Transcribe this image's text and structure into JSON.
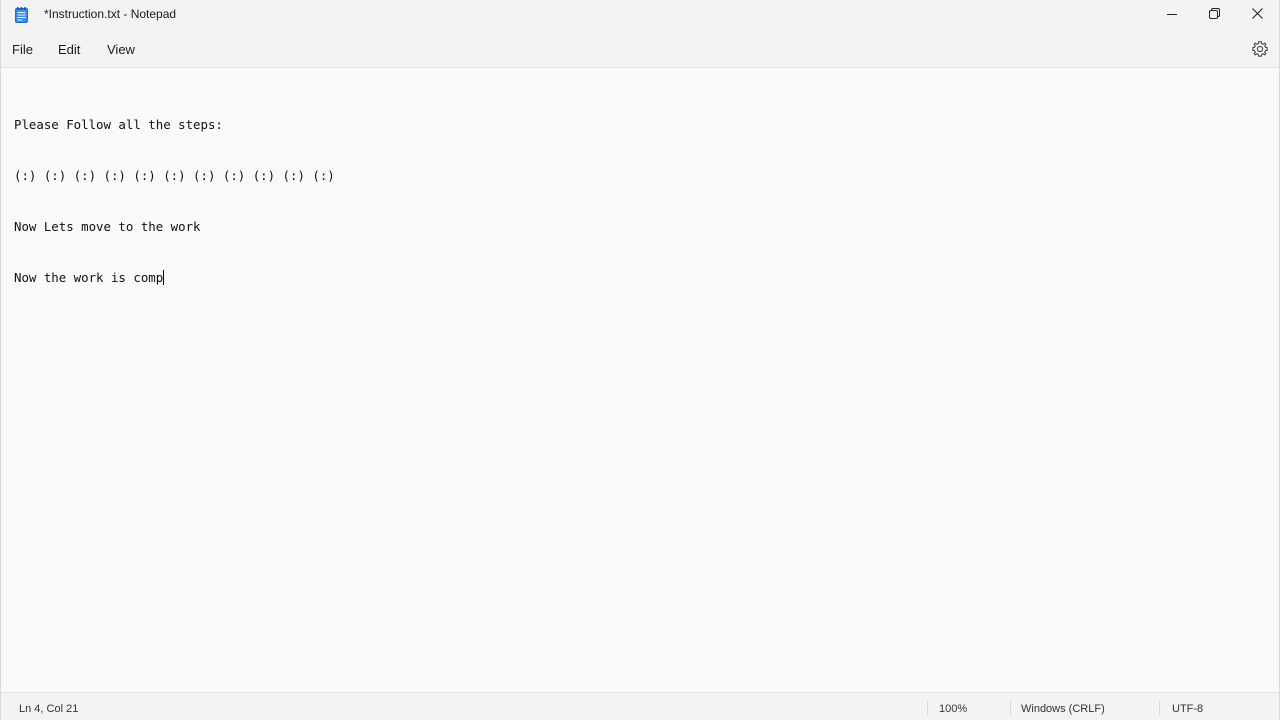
{
  "window": {
    "title": "*Instruction.txt - Notepad"
  },
  "menu": {
    "file": "File",
    "edit": "Edit",
    "view": "View"
  },
  "editor": {
    "lines": [
      "Please Follow all the steps:",
      "(:) (:) (:) (:) (:) (:) (:) (:) (:) (:) (:)",
      "Now Lets move to the work",
      "Now the work is comp"
    ]
  },
  "status": {
    "position": "Ln 4, Col 21",
    "zoom": "100%",
    "line_ending": "Windows (CRLF)",
    "encoding": "UTF-8"
  },
  "icons": {
    "app": "notepad-icon",
    "minimize": "minimize-icon",
    "maximize": "restore-icon",
    "close": "close-icon",
    "settings": "gear-icon"
  },
  "colors": {
    "accent": "#2b7fd6",
    "background": "#f9f9f9",
    "chrome": "#f3f3f3"
  }
}
